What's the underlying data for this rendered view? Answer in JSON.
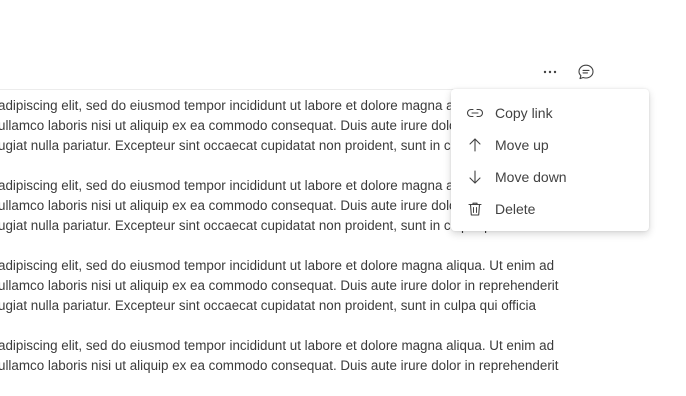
{
  "toolbar": {
    "more_icon": "more-horizontal-icon",
    "comment_icon": "comment-icon"
  },
  "paragraphs": [
    {
      "lines": [
        "adipiscing elit, sed do eiusmod tempor incididunt ut labore et dolore magna aliqua. Ut enim ad",
        "ullamco laboris nisi ut aliquip ex ea commodo consequat. Duis aute irure dolor in reprehenderit",
        "ugiat nulla pariatur. Excepteur sint occaecat cupidatat non proident, sunt in culpa qui officia"
      ]
    },
    {
      "lines": [
        "adipiscing elit, sed do eiusmod tempor incididunt ut labore et dolore magna aliqua. Ut enim ad",
        "ullamco laboris nisi ut aliquip ex ea commodo consequat. Duis aute irure dolor in reprehenderit",
        "ugiat nulla pariatur. Excepteur sint occaecat cupidatat non proident, sunt in culpa qui officia"
      ]
    },
    {
      "lines": [
        "adipiscing elit, sed do eiusmod tempor incididunt ut labore et dolore magna aliqua. Ut enim ad",
        "ullamco laboris nisi ut aliquip ex ea commodo consequat. Duis aute irure dolor in reprehenderit",
        "ugiat nulla pariatur. Excepteur sint occaecat cupidatat non proident, sunt in culpa qui officia"
      ]
    },
    {
      "lines": [
        "adipiscing elit, sed do eiusmod tempor incididunt ut labore et dolore magna aliqua. Ut enim ad",
        "ullamco laboris nisi ut aliquip ex ea commodo consequat. Duis aute irure dolor in reprehenderit"
      ]
    }
  ],
  "context_menu": {
    "items": [
      {
        "label": "Copy link",
        "icon": "link-icon"
      },
      {
        "label": "Move up",
        "icon": "arrow-up-icon"
      },
      {
        "label": "Move down",
        "icon": "arrow-down-icon"
      },
      {
        "label": "Delete",
        "icon": "trash-icon"
      }
    ]
  }
}
